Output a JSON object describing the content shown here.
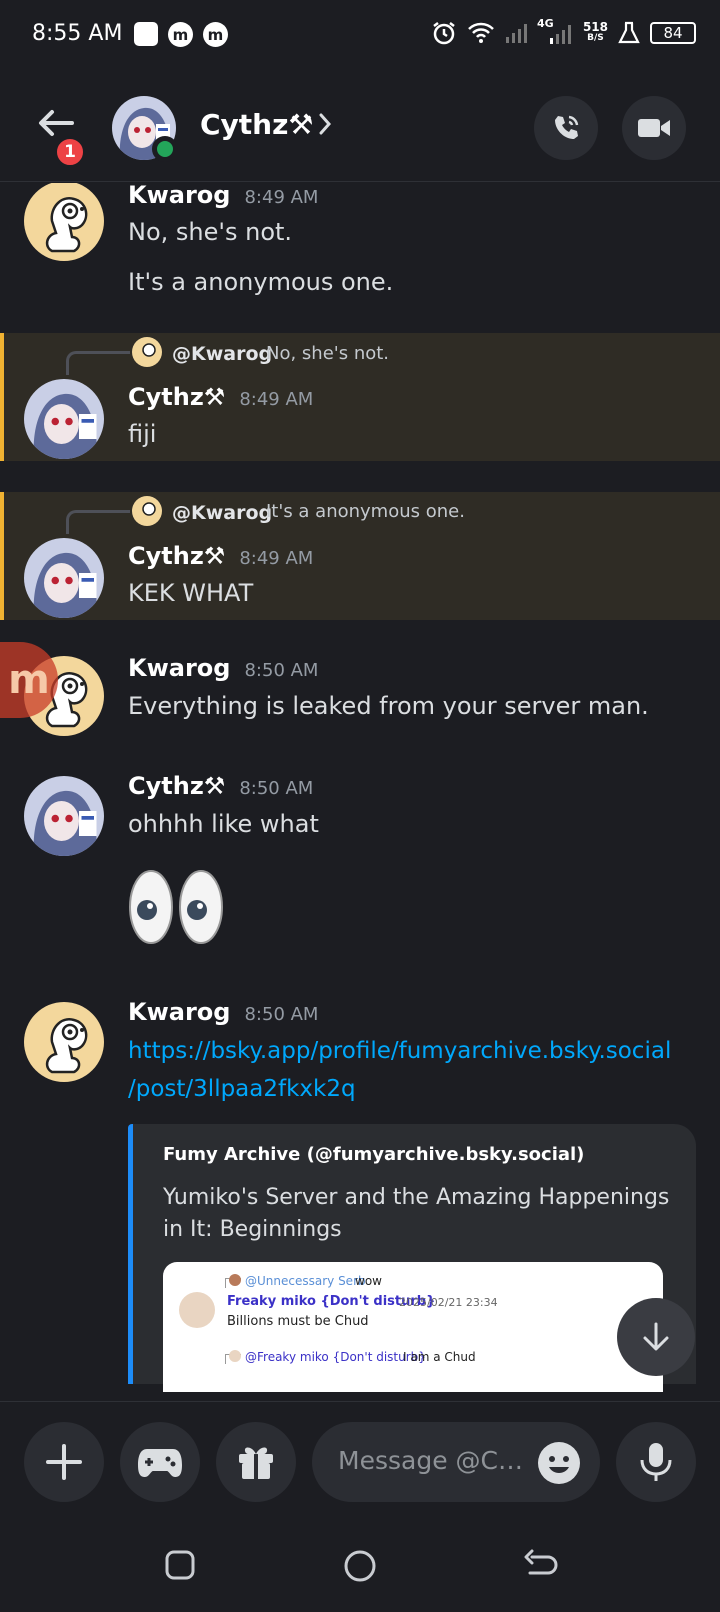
{
  "status_bar": {
    "time": "8:55 AM",
    "network": "4G",
    "speed_value": "518",
    "speed_unit": "B/S",
    "battery": "84",
    "icons": [
      "square-notification-icon",
      "m-app-icon",
      "m-app-icon",
      "alarm-icon",
      "wifi-icon",
      "signal-icon",
      "signal-icon",
      "flask-icon",
      "battery-icon"
    ]
  },
  "header": {
    "back_badge": "1",
    "contact_name": "Cythz⚒",
    "icons": [
      "back-arrow-icon",
      "chevron-right-icon",
      "phone-call-icon",
      "video-camera-icon"
    ]
  },
  "messages": [
    {
      "author": "Kwarog",
      "time": "8:49 AM",
      "lines": [
        "No, she's not.",
        "It's a anonymous one."
      ]
    },
    {
      "author": "Cythz⚒",
      "time": "8:49 AM",
      "reply_to": {
        "name": "@Kwarog",
        "text": "No, she's not."
      },
      "lines": [
        "fiji"
      ]
    },
    {
      "author": "Cythz⚒",
      "time": "8:49 AM",
      "reply_to": {
        "name": "@Kwarog",
        "text": "It's a anonymous one."
      },
      "lines": [
        "KEK WHAT"
      ]
    },
    {
      "author": "Kwarog",
      "time": "8:50 AM",
      "lines": [
        "Everything is leaked from your server man."
      ]
    },
    {
      "author": "Cythz⚒",
      "time": "8:50 AM",
      "lines": [
        "ohhhh like what"
      ]
    },
    {
      "author": "Kwarog",
      "time": "8:50 AM",
      "link_line1": "https://bsky.app/profile/fumyarchive.bsky.social",
      "link_line2": "/post/3llpaa2fkxk2q"
    }
  ],
  "embed": {
    "author": "Fumy Archive (@fumyarchive.bsky.social)",
    "title": "Yumiko's Server and the Amazing Happenings in It: Beginnings",
    "image": {
      "reply1_name": "@Unnecessary Serb",
      "reply1_text": "wow",
      "author": "Freaky miko {Don't disturb}",
      "date": "2025/02/21 23:34",
      "text": "Billions must be Chud",
      "reply2_name": "@Freaky miko {Don't disturb}",
      "reply2_text": "I am a Chud"
    }
  },
  "composer": {
    "placeholder": "Message @C…",
    "icons": [
      "plus-icon",
      "gamepad-icon",
      "gift-icon",
      "emoji-icon",
      "microphone-icon"
    ]
  },
  "nav": {
    "icons": [
      "recents-icon",
      "home-icon",
      "back-icon"
    ]
  },
  "colors": {
    "background": "#1c1d22",
    "highlight": "#2f2c25",
    "highlight_bar": "#f0b232",
    "link": "#00a8fc",
    "online": "#23a55a",
    "badge": "#ed4245"
  }
}
